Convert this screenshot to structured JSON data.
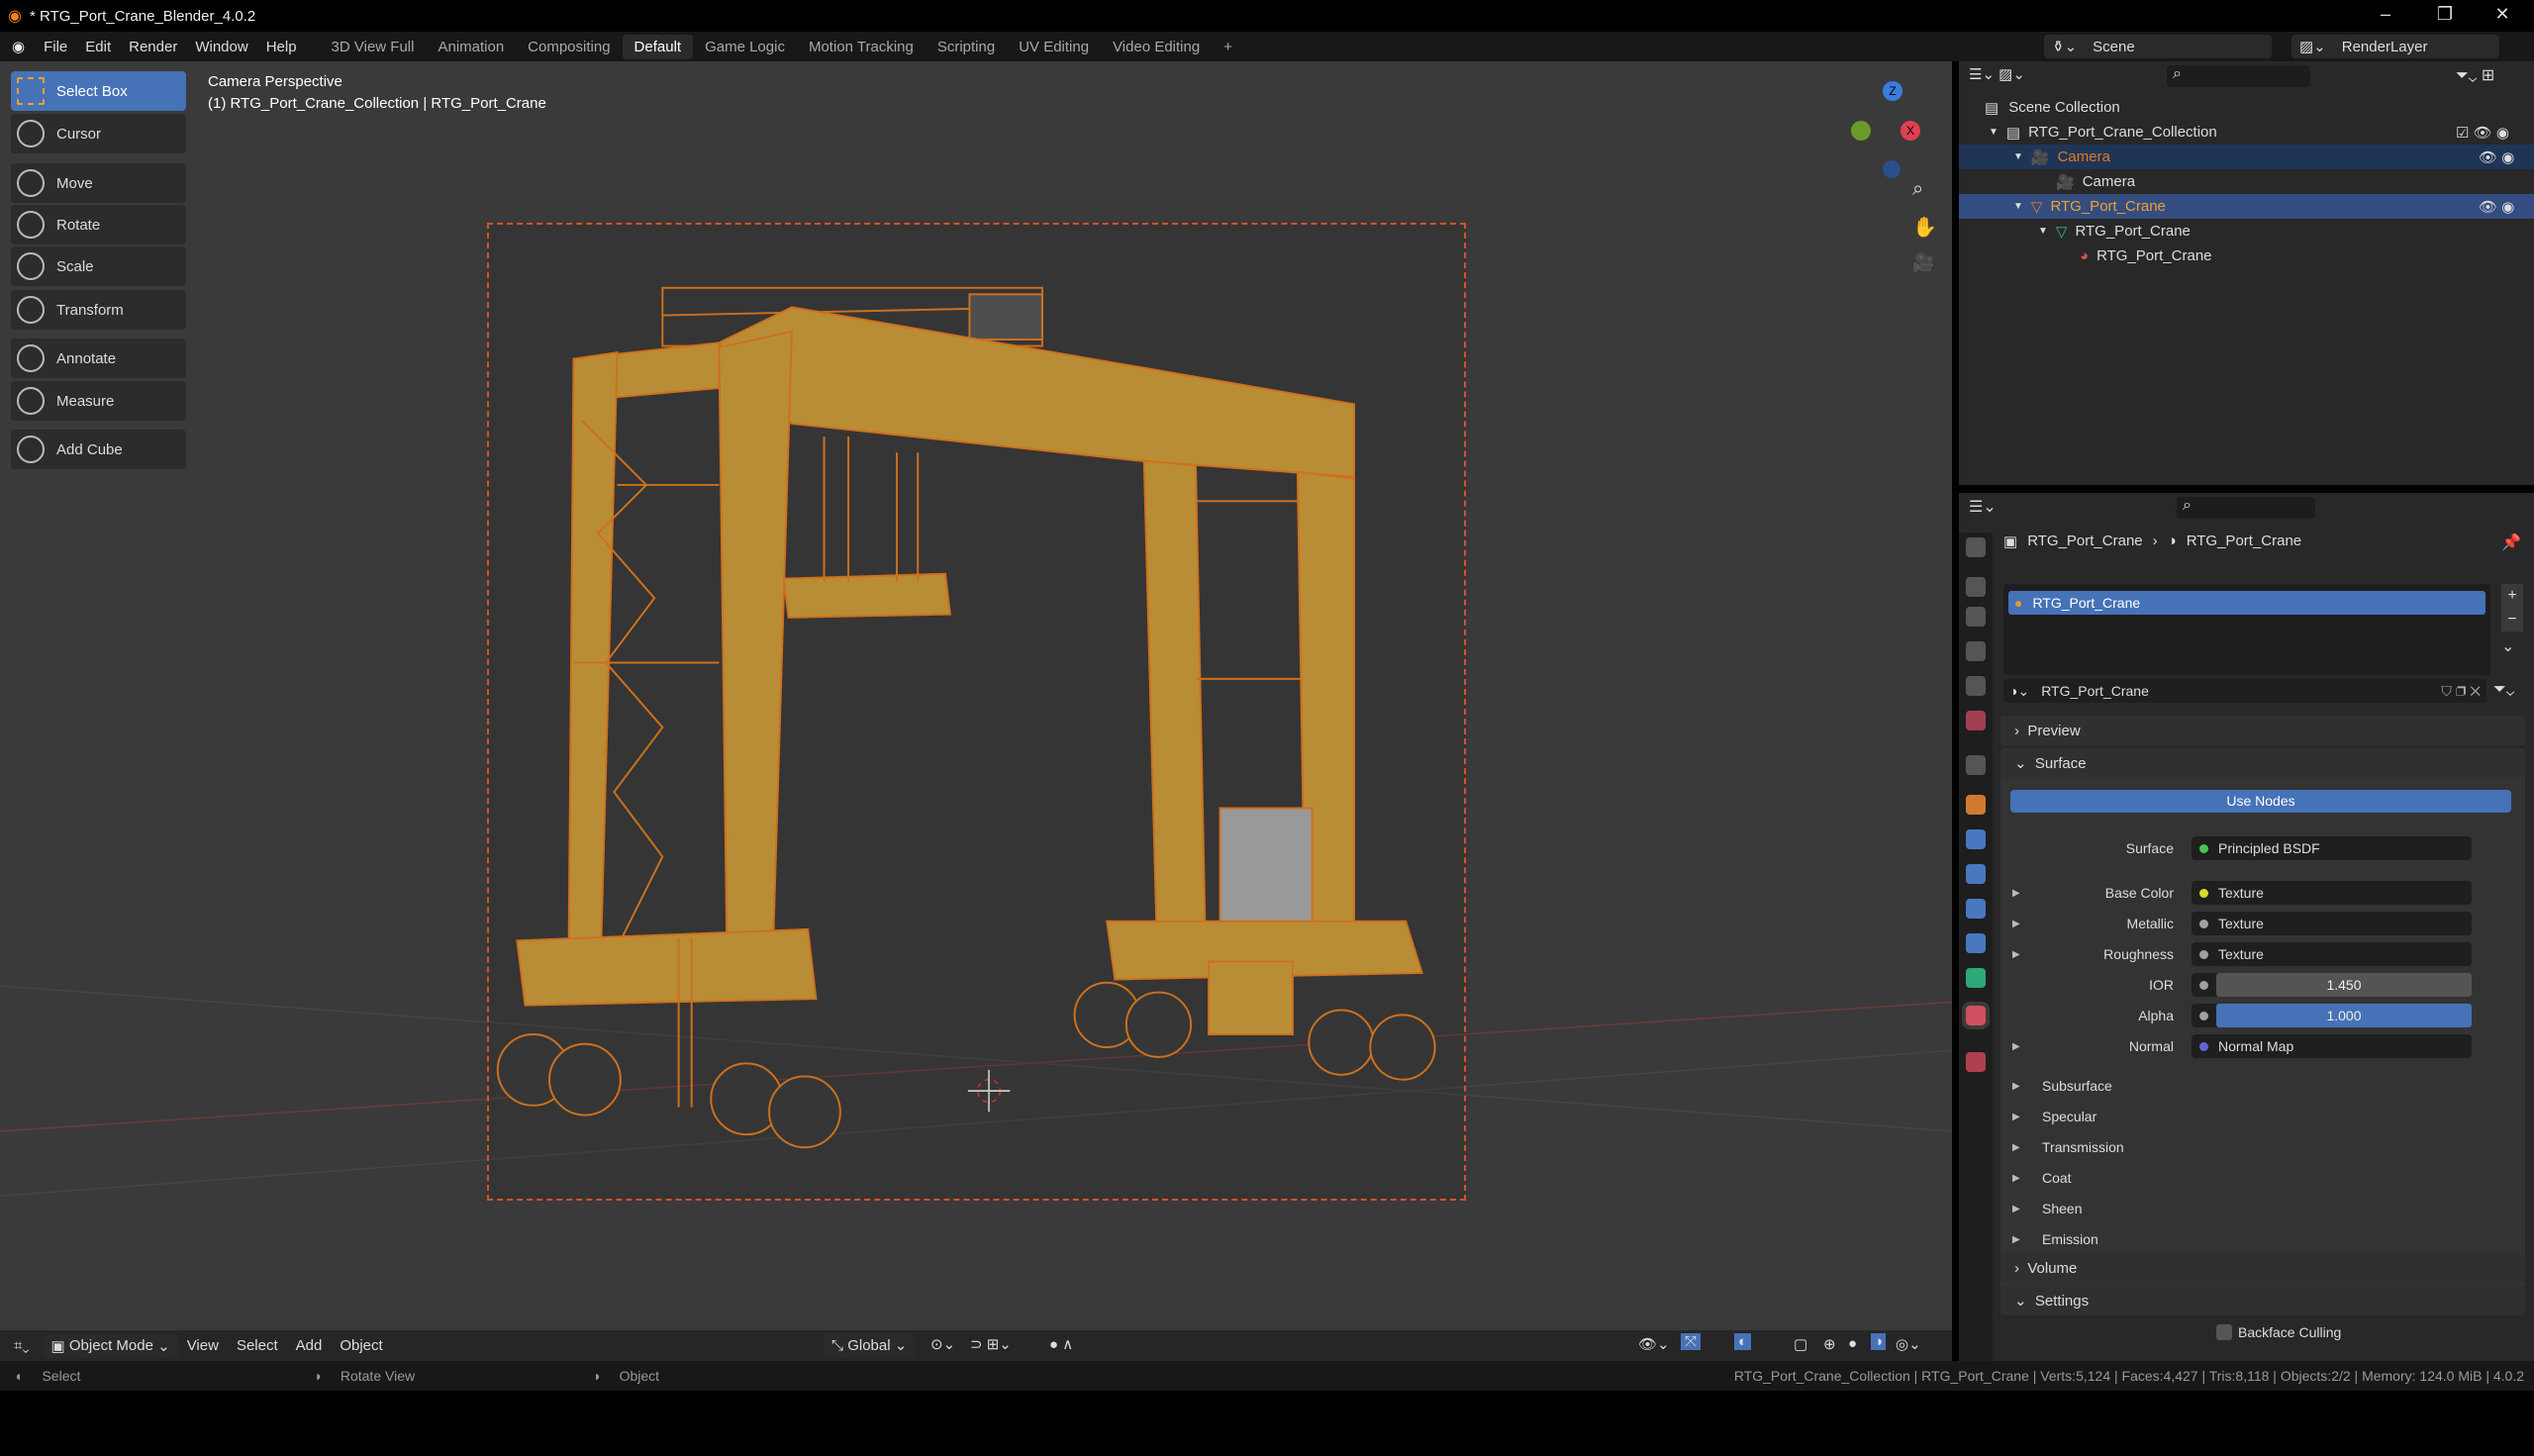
{
  "window": {
    "title": "* RTG_Port_Crane_Blender_4.0.2"
  },
  "menu": [
    "File",
    "Edit",
    "Render",
    "Window",
    "Help"
  ],
  "workspaces": [
    "3D View Full",
    "Animation",
    "Compositing",
    "Default",
    "Game Logic",
    "Motion Tracking",
    "Scripting",
    "UV Editing",
    "Video Editing"
  ],
  "active_workspace": "Default",
  "scene": "Scene",
  "view_layer": "RenderLayer",
  "viewport": {
    "title": "Camera Perspective",
    "subtitle": "(1) RTG_Port_Crane_Collection | RTG_Port_Crane"
  },
  "tools": [
    "Select Box",
    "Cursor",
    "Move",
    "Rotate",
    "Scale",
    "Transform",
    "Annotate",
    "Measure",
    "Add Cube"
  ],
  "gizmo": {
    "z": "Z",
    "x": "X"
  },
  "header": {
    "mode": "Object Mode",
    "menus": [
      "View",
      "Select",
      "Add",
      "Object"
    ],
    "orientation": "Global"
  },
  "outliner": {
    "root": "Scene Collection",
    "items": [
      {
        "label": "RTG_Port_Crane_Collection"
      },
      {
        "label": "Camera"
      },
      {
        "label": "Camera"
      },
      {
        "label": "RTG_Port_Crane"
      },
      {
        "label": "RTG_Port_Crane"
      },
      {
        "label": "RTG_Port_Crane"
      }
    ]
  },
  "properties": {
    "breadcrumb": [
      "RTG_Port_Crane",
      "RTG_Port_Crane"
    ],
    "slot": "RTG_Port_Crane",
    "material": "RTG_Port_Crane",
    "preview": "Preview",
    "surface_panel": "Surface",
    "use_nodes": "Use Nodes",
    "fields": [
      {
        "label": "Surface",
        "value": "Principled BSDF",
        "color": "#4fc24f"
      },
      {
        "label": "Base Color",
        "value": "Texture",
        "color": "#d9d92a"
      },
      {
        "label": "Metallic",
        "value": "Texture",
        "color": "#a0a0a0"
      },
      {
        "label": "Roughness",
        "value": "Texture",
        "color": "#a0a0a0"
      },
      {
        "label": "IOR",
        "value": "1.450"
      },
      {
        "label": "Alpha",
        "value": "1.000"
      },
      {
        "label": "Normal",
        "value": "Normal Map",
        "color": "#6363d8"
      }
    ],
    "subpanels": [
      "Subsurface",
      "Specular",
      "Transmission",
      "Coat",
      "Sheen",
      "Emission"
    ],
    "volume": "Volume",
    "settings": "Settings",
    "backface": "Backface Culling"
  },
  "status": {
    "left": [
      "Select",
      "Rotate View",
      "Object"
    ],
    "right": "RTG_Port_Crane_Collection | RTG_Port_Crane | Verts:5,124 | Faces:4,427 | Tris:8,118 | Objects:2/2 | Memory: 124.0 MiB | 4.0.2"
  }
}
